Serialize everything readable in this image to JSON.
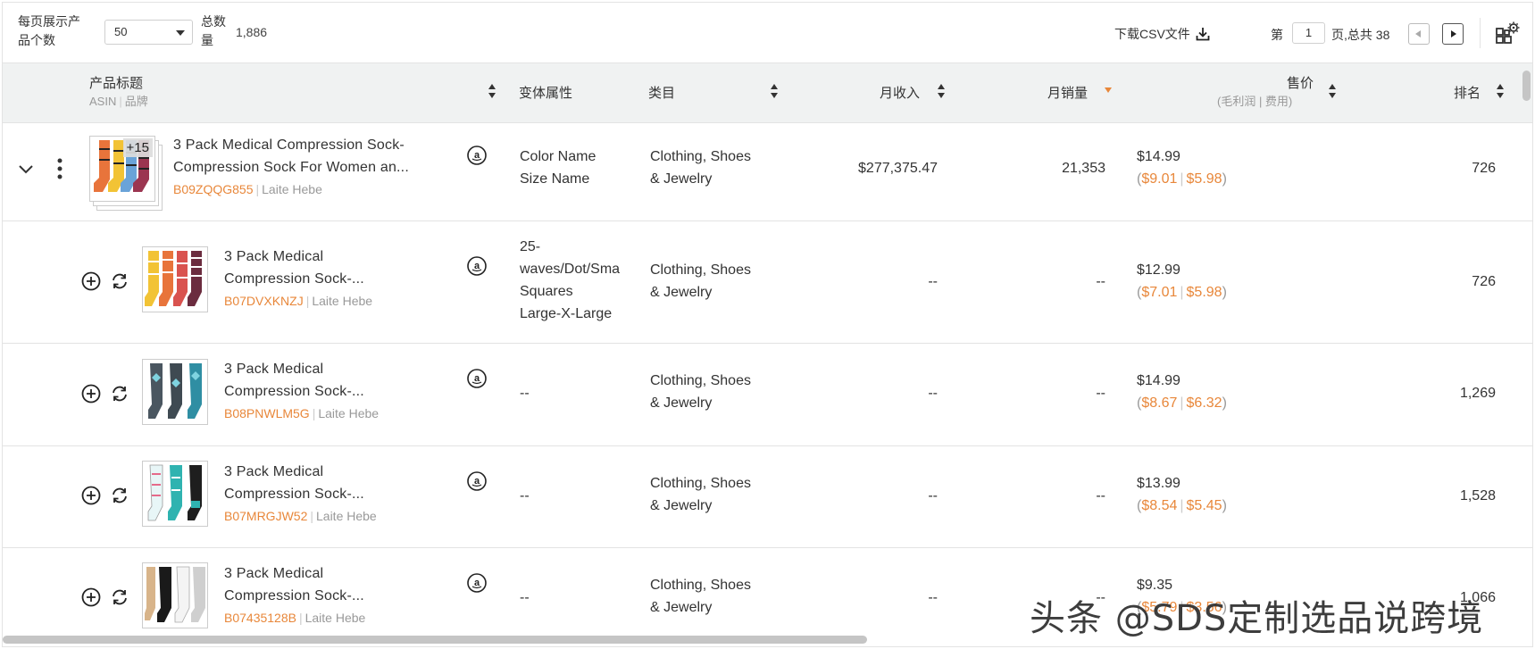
{
  "toolbar": {
    "per_page_label": "每页展示产品个数",
    "per_page_value": "50",
    "total_label": "总数量",
    "total_value": "1,886",
    "csv_label": "下载CSV文件",
    "page_prefix": "第",
    "page_value": "1",
    "page_suffix": "页,总共 38"
  },
  "header": {
    "title": "产品标题",
    "title_sub_asin": "ASIN",
    "title_sub_brand": "品牌",
    "variant": "变体属性",
    "category": "类目",
    "revenue": "月收入",
    "sales": "月销量",
    "price": "售价",
    "price_sub": "(毛利润 | 费用)",
    "rank": "排名"
  },
  "parent": {
    "badge": "+15",
    "title_line1": "3 Pack Medical Compression Sock-",
    "title_line2": "Compression Sock For Women an...",
    "asin": "B09ZQQG855",
    "brand": "Laite Hebe",
    "variant_line1": "Color Name",
    "variant_line2": "Size Name",
    "category_line1": "Clothing, Shoes",
    "category_line2": "& Jewelry",
    "revenue": "$277,375.47",
    "sales": "21,353",
    "price": "$14.99",
    "profit": "$9.01",
    "fee": "$5.98",
    "rank": "726"
  },
  "rows": [
    {
      "title_line1": "3 Pack Medical",
      "title_line2": "Compression Sock-...",
      "asin": "B07DVXKNZJ",
      "brand": "Laite Hebe",
      "variant": [
        "25-",
        "waves/Dot/Sma",
        "Squares",
        "Large-X-Large"
      ],
      "category_line1": "Clothing, Shoes",
      "category_line2": "& Jewelry",
      "revenue": "--",
      "sales": "--",
      "price": "$12.99",
      "profit": "$7.01",
      "fee": "$5.98",
      "rank": "726"
    },
    {
      "title_line1": "3 Pack Medical",
      "title_line2": "Compression Sock-...",
      "asin": "B08PNWLM5G",
      "brand": "Laite Hebe",
      "variant": [
        "--"
      ],
      "category_line1": "Clothing, Shoes",
      "category_line2": "& Jewelry",
      "revenue": "--",
      "sales": "--",
      "price": "$14.99",
      "profit": "$8.67",
      "fee": "$6.32",
      "rank": "1,269"
    },
    {
      "title_line1": "3 Pack Medical",
      "title_line2": "Compression Sock-...",
      "asin": "B07MRGJW52",
      "brand": "Laite Hebe",
      "variant": [
        "--"
      ],
      "category_line1": "Clothing, Shoes",
      "category_line2": "& Jewelry",
      "revenue": "--",
      "sales": "--",
      "price": "$13.99",
      "profit": "$8.54",
      "fee": "$5.45",
      "rank": "1,528"
    },
    {
      "title_line1": "3 Pack Medical",
      "title_line2": "Compression Sock-...",
      "asin": "B07435128B",
      "brand": "Laite Hebe",
      "variant": [
        "--"
      ],
      "category_line1": "Clothing, Shoes",
      "category_line2": "& Jewelry",
      "revenue": "--",
      "sales": "--",
      "price": "$9.35",
      "profit": "$5.79",
      "fee": "$3.56",
      "rank": "1,066"
    }
  ],
  "watermark": "头条 @SDS定制选品说跨境",
  "colors": {
    "accent_orange": "#e8873a",
    "header_bg": "#f0f2f2",
    "border": "#e3e3e3"
  }
}
